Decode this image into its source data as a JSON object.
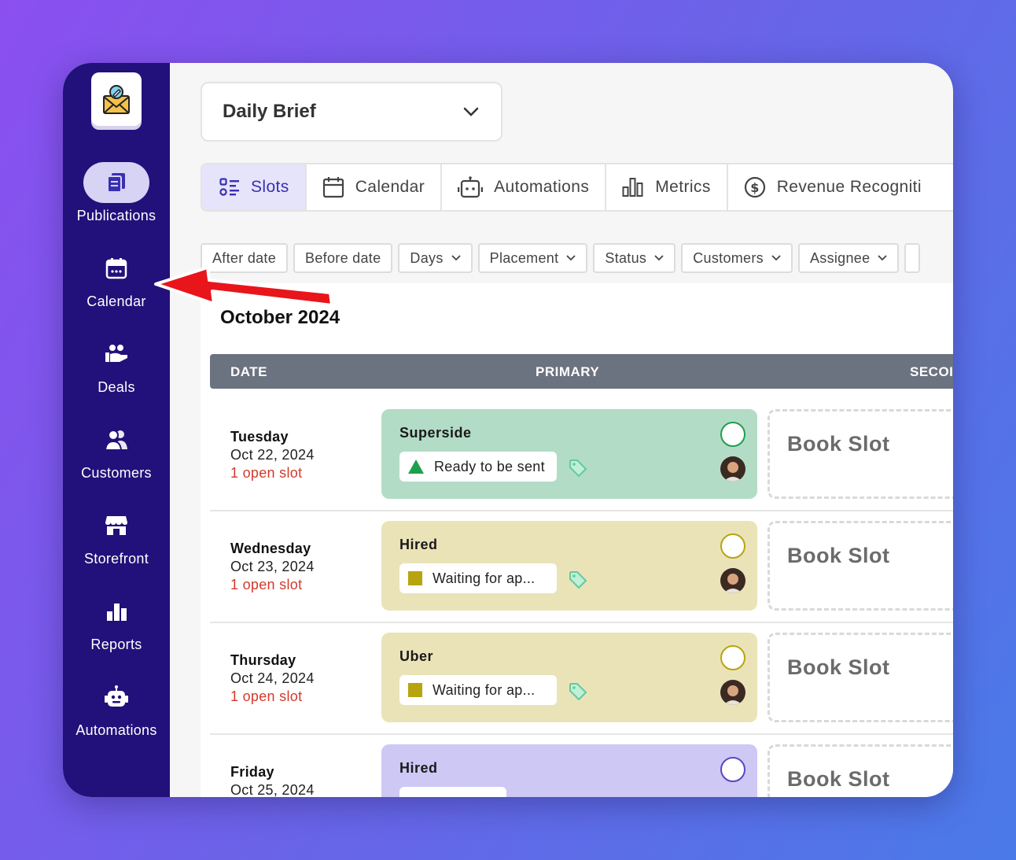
{
  "sidebar": {
    "items": [
      {
        "label": "Publications",
        "icon": "publications-icon"
      },
      {
        "label": "Calendar",
        "icon": "calendar-icon"
      },
      {
        "label": "Deals",
        "icon": "deals-icon"
      },
      {
        "label": "Customers",
        "icon": "customers-icon"
      },
      {
        "label": "Storefront",
        "icon": "storefront-icon"
      },
      {
        "label": "Reports",
        "icon": "reports-icon"
      },
      {
        "label": "Automations",
        "icon": "robot-icon"
      }
    ]
  },
  "header": {
    "dropdown_value": "Daily Brief"
  },
  "tabs": [
    {
      "label": "Slots"
    },
    {
      "label": "Calendar"
    },
    {
      "label": "Automations"
    },
    {
      "label": "Metrics"
    },
    {
      "label": "Revenue Recogniti"
    }
  ],
  "filters": [
    {
      "label": "After date"
    },
    {
      "label": "Before date"
    },
    {
      "label": "Days"
    },
    {
      "label": "Placement"
    },
    {
      "label": "Status"
    },
    {
      "label": "Customers"
    },
    {
      "label": "Assignee"
    }
  ],
  "month_title": "October 2024",
  "table": {
    "headers": {
      "date": "DATE",
      "primary": "PRIMARY",
      "secondary": "SECOI"
    },
    "rows": [
      {
        "day": "Tuesday",
        "date": "Oct 22, 2024",
        "slots": "1 open slot",
        "customer": "Superside",
        "status": "Ready to be sent",
        "book": "Book Slot"
      },
      {
        "day": "Wednesday",
        "date": "Oct 23, 2024",
        "slots": "1 open slot",
        "customer": "Hired",
        "status": "Waiting for ap...",
        "book": "Book Slot"
      },
      {
        "day": "Thursday",
        "date": "Oct 24, 2024",
        "slots": "1 open slot",
        "customer": "Uber",
        "status": "Waiting for ap...",
        "book": "Book Slot"
      },
      {
        "day": "Friday",
        "date": "Oct 25, 2024",
        "slots": "",
        "customer": "Hired",
        "status": "",
        "book": "Book Slot"
      }
    ]
  },
  "colors": {
    "sidebar": "#22117a",
    "accent": "#3a2fb0",
    "card_green": "#b3dcc7",
    "card_yellow": "#ebe3b8",
    "card_purple": "#cdc8f4",
    "status_green": "#1f9f4e",
    "status_olive": "#b8a40f",
    "open_slot_red": "#d23a2c",
    "arrow_red": "#e8151b"
  }
}
